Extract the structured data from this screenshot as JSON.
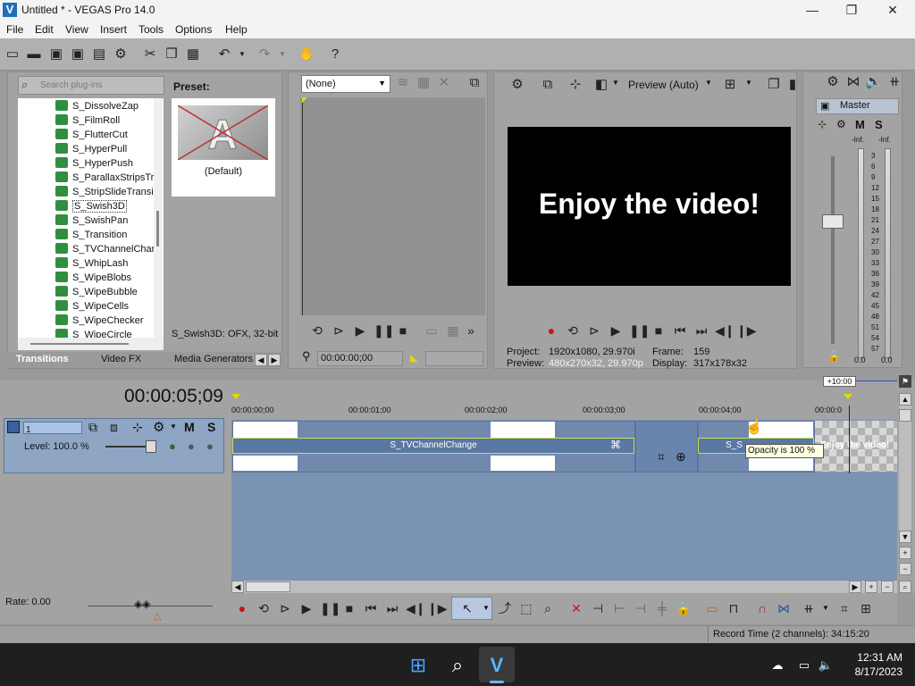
{
  "window": {
    "title": "Untitled * - VEGAS Pro 14.0",
    "logo": "V",
    "minimize": "—",
    "maximize": "❐",
    "close": "✕"
  },
  "menu": [
    "File",
    "Edit",
    "View",
    "Insert",
    "Tools",
    "Options",
    "Help"
  ],
  "explorer": {
    "search_placeholder": "Search plug-ins",
    "items": [
      "S_DissolveZap",
      "S_FilmRoll",
      "S_FlutterCut",
      "S_HyperPull",
      "S_HyperPush",
      "S_ParallaxStripsTr",
      "S_StripSlideTransi",
      "S_Swish3D",
      "S_SwishPan",
      "S_Transition",
      "S_TVChannelChar",
      "S_WhipLash",
      "S_WipeBlobs",
      "S_WipeBubble",
      "S_WipeCells",
      "S_WipeChecker",
      "S_WipeCircle"
    ],
    "selected_index": 7,
    "preset_label": "Preset:",
    "preset_name": "(Default)",
    "status": "S_Swish3D: OFX, 32-bit",
    "tabs": [
      "Transitions",
      "Video FX",
      "Media Generators"
    ]
  },
  "trimmer": {
    "select_value": "(None)",
    "timecode": "00:00:00;00"
  },
  "preview": {
    "mode_label": "Preview (Auto)",
    "video_text": "Enjoy the video!",
    "project_label": "Project:",
    "project_value": "1920x1080, 29.970i",
    "preview_label": "Preview:",
    "preview_value": "480x270x32, 29.970p",
    "frame_label": "Frame:",
    "frame_value": "159",
    "display_label": "Display:",
    "display_value": "317x178x32"
  },
  "mixer": {
    "master_label": "Master",
    "m_label": "M",
    "s_label": "S",
    "inf_left": "-Inf.",
    "inf_right": "-Inf.",
    "scale": [
      "3",
      "6",
      "9",
      "12",
      "15",
      "18",
      "21",
      "24",
      "27",
      "30",
      "33",
      "36",
      "39",
      "42",
      "45",
      "48",
      "51",
      "54",
      "57"
    ],
    "level_left": "0.0",
    "level_right": "0.0"
  },
  "timeline": {
    "timecode": "00:00:05;09",
    "marker_label": "+10:00",
    "ruler": [
      "00:00:00;00",
      "00:00:01;00",
      "00:00:02;00",
      "00:00:03;00",
      "00:00:04;00",
      "00:00:0"
    ],
    "track_number": "1",
    "track_m": "M",
    "track_s": "S",
    "level_label": "Level: 100.0 %",
    "transition_label": "S_TVChannelChange",
    "transition2_label": "S_S",
    "event_text": "Enjoy the video!",
    "tooltip": "Opacity is 100 %",
    "rate_label": "Rate: 0.00"
  },
  "status": {
    "record_time": "Record Time (2 channels): 34:15:20"
  },
  "taskbar": {
    "time": "12:31 AM",
    "date": "8/17/2023"
  }
}
